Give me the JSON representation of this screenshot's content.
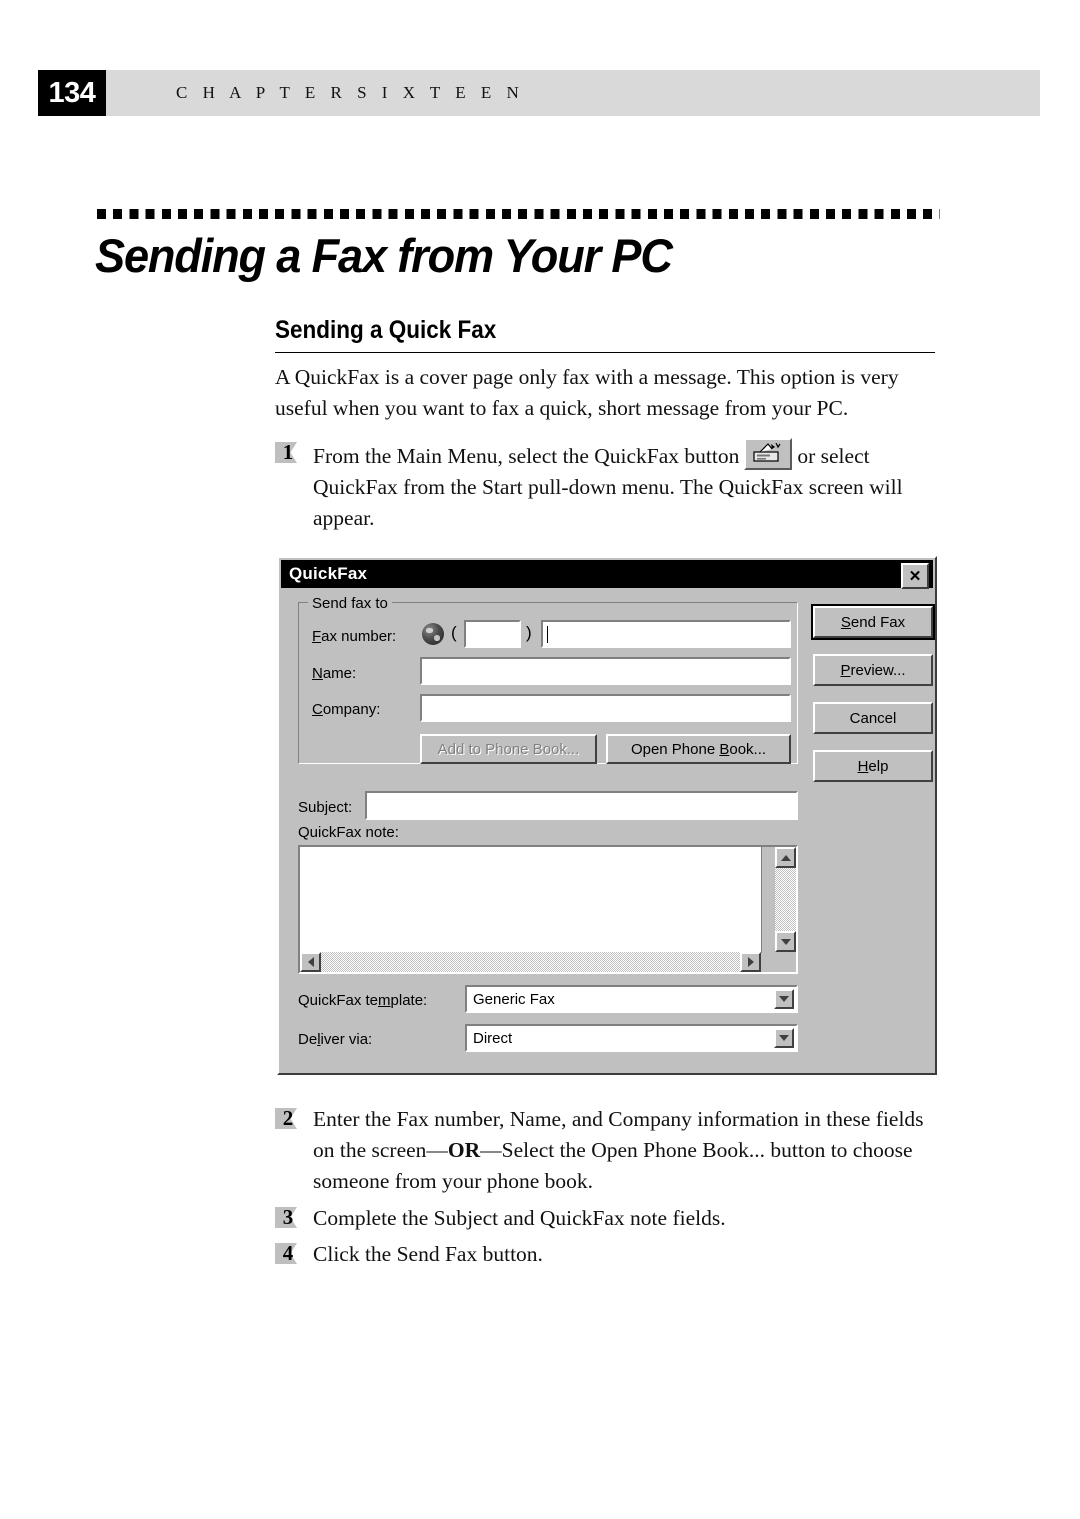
{
  "header": {
    "page_number": "134",
    "chapter_label": "C H A P T E R   S I X T E E N"
  },
  "chapter_title": "Sending a Fax from Your PC",
  "section_heading": "Sending a Quick Fax",
  "intro_paragraph": "A QuickFax is a cover page only fax with a message.  This option is very useful when you want to fax a quick, short message from your PC.",
  "steps": {
    "one": {
      "number": "1",
      "text_before_icon": "From the Main Menu, select the QuickFax button",
      "icon": "fax-machine-icon",
      "text_after_icon": "or select QuickFax  from the Start pull-down menu.  The QuickFax screen will appear."
    },
    "two": {
      "number": "2",
      "part1": "Enter the Fax number, Name, and Company information in these fields on the screen—",
      "emphasis": "OR",
      "part2": "—Select the Open Phone Book... button to choose someone from your phone book."
    },
    "three": {
      "number": "3",
      "text": "Complete the Subject and QuickFax note fields."
    },
    "four": {
      "number": "4",
      "text": "Click the Send Fax button."
    }
  },
  "dialog": {
    "title": "QuickFax",
    "close_label": "✕",
    "groupbox_label": "Send fax to",
    "fields": {
      "fax_number_label": "Fax number:",
      "fax_area_open_paren": "(",
      "fax_area_close_paren": ")",
      "fax_area_value": "",
      "fax_number_value": "",
      "name_label": "Name:",
      "name_value": "",
      "company_label": "Company:",
      "company_value": "",
      "subject_label": "Subject:",
      "subject_value": "",
      "note_label": "QuickFax note:",
      "note_value": "",
      "template_label": "QuickFax template:",
      "template_value": "Generic Fax",
      "deliver_label": "Deliver via:",
      "deliver_value": "Direct"
    },
    "buttons": {
      "add_to_phone_book": "Add to Phone Book...",
      "open_phone_book": "Open Phone Book...",
      "send_fax": "Send Fax",
      "preview": "Preview...",
      "cancel": "Cancel",
      "help": "Help"
    }
  },
  "colors": {
    "dialog_face": "#c0c0c0",
    "titlebar": "#000000",
    "header_bar": "#d9d9d9",
    "page_badge": "#000000",
    "disabled_text": "#808080"
  }
}
